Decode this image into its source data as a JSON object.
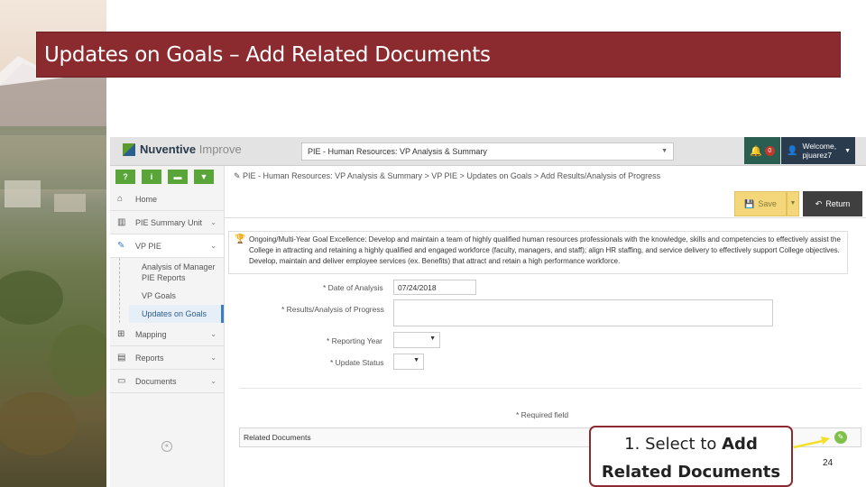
{
  "slide": {
    "title": "Updates on Goals – Add Related Documents",
    "page_number": "24",
    "callout": {
      "prefix": "1. Select to ",
      "bold1": "Add",
      "bold2": "Related Documents"
    }
  },
  "app": {
    "logo_brand": "Nuventive",
    "logo_product": "Improve",
    "unit_selector": "PIE - Human Resources: VP Analysis & Summary",
    "notification_count": "0",
    "user_greeting": "Welcome,",
    "user_name": "pjuarez7",
    "breadcrumb": "PIE - Human Resources: VP Analysis & Summary  >  VP PIE  >  Updates on Goals  >  Add Results/Analysis of Progress"
  },
  "sidebar": {
    "tools": [
      "?",
      "i",
      "▬",
      "▼"
    ],
    "items": [
      {
        "label": "Home",
        "icon": "home-icon"
      },
      {
        "label": "PIE Summary Unit",
        "icon": "building-icon"
      },
      {
        "label": "VP PIE",
        "icon": "pencil-icon"
      },
      {
        "label": "Mapping",
        "icon": "sitemap-icon"
      },
      {
        "label": "Reports",
        "icon": "columns-icon"
      },
      {
        "label": "Documents",
        "icon": "folder-icon"
      }
    ],
    "sub_items": [
      "Analysis of Manager PIE Reports",
      "VP Goals",
      "Updates on Goals"
    ]
  },
  "toolbar": {
    "save_label": "Save",
    "return_label": "Return"
  },
  "goal": {
    "text": "Ongoing/Multi-Year Goal Excellence: Develop and maintain a team of highly qualified human resources professionals with the knowledge, skills and competencies to effectively assist the College in attracting and retaining a highly qualified and engaged workforce (faculty, managers, and staff); align HR staffing, and service delivery to effectively support College objectives. Develop, maintain and deliver employee services (ex. Benefits) that attract and retain a high performance workforce."
  },
  "form": {
    "date_label": "* Date of Analysis",
    "date_value": "07/24/2018",
    "results_label": "* Results/Analysis of Progress",
    "year_label": "* Reporting Year",
    "status_label": "* Update Status",
    "required_note": "* Required field",
    "related_docs_label": "Related Documents"
  },
  "colors": {
    "title_bar": "#8b2b2f",
    "sidebar_tool": "#5aa53a",
    "save": "#f3d77a",
    "return": "#3f3f3f",
    "arrow": "#f3e02a"
  }
}
